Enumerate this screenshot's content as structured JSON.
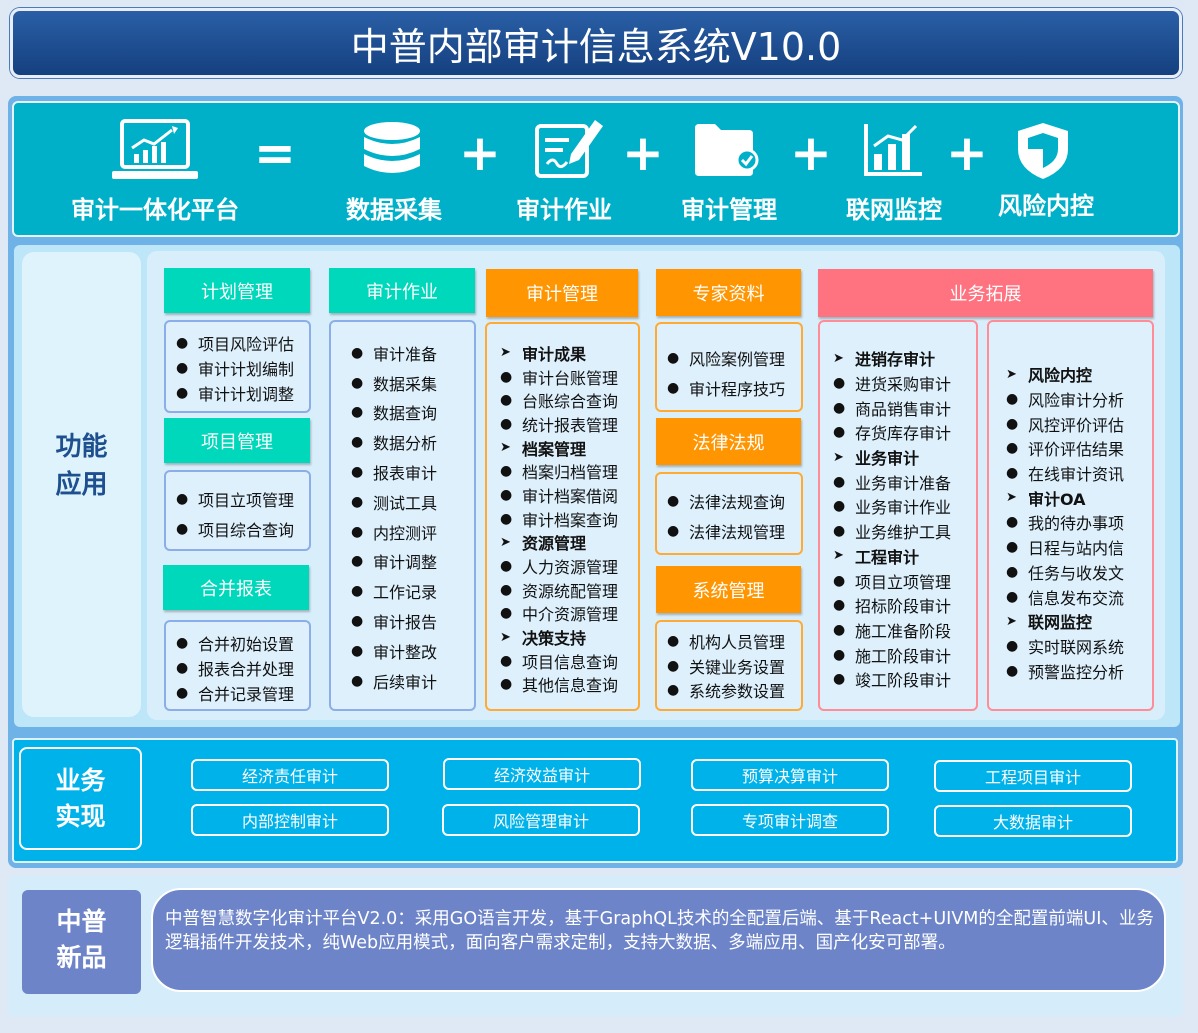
{
  "title": "中普内部审计信息系统V10.0",
  "top": {
    "platform": "审计一体化平台",
    "modules": [
      "数据采集",
      "审计作业",
      "审计管理",
      "联网监控",
      "风险内控"
    ],
    "equals": "=",
    "plus": "+"
  },
  "func": {
    "label_line1": "功能",
    "label_line2": "应用",
    "jihua": {
      "title": "计划管理",
      "items": [
        "项目风险评估",
        "审计计划编制",
        "审计计划调整"
      ]
    },
    "xiangmu": {
      "title": "项目管理",
      "items": [
        "项目立项管理",
        "项目综合查询"
      ]
    },
    "hebing": {
      "title": "合并报表",
      "items": [
        "合并初始设置",
        "报表合并处理",
        "合并记录管理"
      ]
    },
    "zuoye": {
      "title": "审计作业",
      "items": [
        "审计准备",
        "数据采集",
        "数据查询",
        "数据分析",
        "报表审计",
        "测试工具",
        "内控测评",
        "审计调整",
        "工作记录",
        "审计报告",
        "审计整改",
        "后续审计"
      ]
    },
    "guanli": {
      "title": "审计管理",
      "items": [
        {
          "t": "审计成果",
          "h": true
        },
        {
          "t": "审计台账管理"
        },
        {
          "t": "台账综合查询"
        },
        {
          "t": "统计报表管理"
        },
        {
          "t": "档案管理",
          "h": true
        },
        {
          "t": "档案归档管理"
        },
        {
          "t": "审计档案借阅"
        },
        {
          "t": "审计档案查询"
        },
        {
          "t": "资源管理",
          "h": true
        },
        {
          "t": "人力资源管理"
        },
        {
          "t": "资源统配管理"
        },
        {
          "t": "中介资源管理"
        },
        {
          "t": "决策支持",
          "h": true
        },
        {
          "t": "项目信息查询"
        },
        {
          "t": "其他信息查询"
        }
      ]
    },
    "zhuanjia": {
      "title": "专家资料",
      "items": [
        "风险案例管理",
        "审计程序技巧"
      ]
    },
    "falv": {
      "title": "法律法规",
      "items": [
        "法律法规查询",
        "法律法规管理"
      ]
    },
    "xitong": {
      "title": "系统管理",
      "items": [
        "机构人员管理",
        "关键业务设置",
        "系统参数设置"
      ]
    },
    "tuozhan": {
      "title": "业务拓展",
      "left": [
        {
          "t": "进销存审计",
          "h": true
        },
        {
          "t": "进货采购审计"
        },
        {
          "t": "商品销售审计"
        },
        {
          "t": "存货库存审计"
        },
        {
          "t": "业务审计",
          "h": true
        },
        {
          "t": "业务审计准备"
        },
        {
          "t": "业务审计作业"
        },
        {
          "t": "业务维护工具"
        },
        {
          "t": "工程审计",
          "h": true
        },
        {
          "t": "项目立项管理"
        },
        {
          "t": "招标阶段审计"
        },
        {
          "t": "施工准备阶段"
        },
        {
          "t": "施工阶段审计"
        },
        {
          "t": "竣工阶段审计"
        }
      ],
      "right": [
        {
          "t": "风险内控",
          "h": true
        },
        {
          "t": "风险审计分析"
        },
        {
          "t": "风控评价评估"
        },
        {
          "t": "评价评估结果"
        },
        {
          "t": "在线审计资讯"
        },
        {
          "t": "审计OA",
          "h": true
        },
        {
          "t": "我的待办事项"
        },
        {
          "t": "日程与站内信"
        },
        {
          "t": "任务与收发文"
        },
        {
          "t": "信息发布交流"
        },
        {
          "t": "联网监控",
          "h": true
        },
        {
          "t": "实时联网系统"
        },
        {
          "t": "预警监控分析"
        }
      ]
    }
  },
  "biz": {
    "label_line1": "业务",
    "label_line2": "实现",
    "buttons": [
      "经济责任审计",
      "经济效益审计",
      "预算决算审计",
      "工程项目审计",
      "内部控制审计",
      "风险管理审计",
      "专项审计调查",
      "大数据审计"
    ]
  },
  "new": {
    "label_line1": "中普",
    "label_line2": "新品",
    "text": "中普智慧数字化审计平台V2.0：采用GO语言开发，基于GraphQL技术的全配置后端、基于React+UIVM的全配置前端UI、业务逻辑插件开发技术，纯Web应用模式，面向客户需求定制，支持大数据、多端应用、国产化安可部署。"
  },
  "icons": [
    "laptop-chart-icon",
    "database-icon",
    "edit-document-icon",
    "folder-check-icon",
    "bar-chart-icon",
    "shield-icon"
  ],
  "colors": {
    "teal": "#00d8bb",
    "orange": "#ff9500",
    "pink": "#ff727f",
    "title_blue": "#1a4a8c",
    "top_bar": "#00b0c8"
  }
}
